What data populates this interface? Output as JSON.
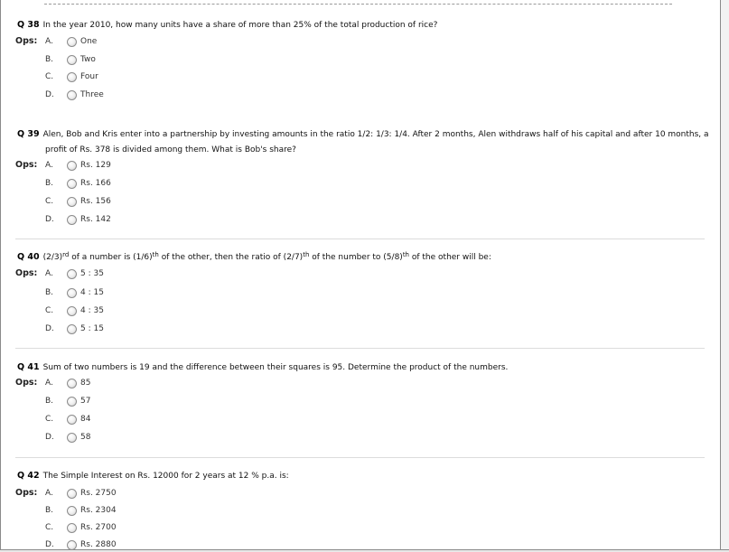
{
  "ops_label": "Ops:",
  "questions": [
    {
      "number": "Q 38",
      "text": "In the year 2010, how many units have a share of more than 25% of the total production of rice?",
      "options": [
        {
          "letter": "A.",
          "text": "One"
        },
        {
          "letter": "B.",
          "text": "Two"
        },
        {
          "letter": "C.",
          "text": "Four"
        },
        {
          "letter": "D.",
          "text": "Three"
        }
      ]
    },
    {
      "number": "Q 39",
      "text_line1": "Alen, Bob and Kris enter into a partnership by investing amounts in the ratio 1/2: 1/3: 1/4. After 2 months, Alen withdraws half of his capital and after 10 months, a",
      "text_line2": "profit of Rs. 378 is divided among them. What is Bob's share?",
      "options": [
        {
          "letter": "A.",
          "text": "Rs. 129"
        },
        {
          "letter": "B.",
          "text": "Rs. 166"
        },
        {
          "letter": "C.",
          "text": "Rs. 156"
        },
        {
          "letter": "D.",
          "text": "Rs. 142"
        }
      ]
    },
    {
      "number": "Q 40",
      "text_parts": {
        "p1": "(2/3)",
        "s1": "rd",
        "p2": " of a number is (1/6)",
        "s2": "th",
        "p3": " of the other, then the ratio of (2/7)",
        "s3": "th",
        "p4": " of the number to (5/8)",
        "s4": "th",
        "p5": " of the other will be:"
      },
      "options": [
        {
          "letter": "A.",
          "text": "5 : 35"
        },
        {
          "letter": "B.",
          "text": "4 : 15"
        },
        {
          "letter": "C.",
          "text": "4 : 35"
        },
        {
          "letter": "D.",
          "text": "5 : 15"
        }
      ]
    },
    {
      "number": "Q 41",
      "text": "Sum of two numbers is 19 and the difference between their squares is 95. Determine the product of the numbers.",
      "options": [
        {
          "letter": "A.",
          "text": "85"
        },
        {
          "letter": "B.",
          "text": "57"
        },
        {
          "letter": "C.",
          "text": "84"
        },
        {
          "letter": "D.",
          "text": "58"
        }
      ]
    },
    {
      "number": "Q 42",
      "text": "The Simple Interest on Rs. 12000 for 2 years at 12 % p.a. is:",
      "options": [
        {
          "letter": "A.",
          "text": "Rs. 2750"
        },
        {
          "letter": "B.",
          "text": "Rs. 2304"
        },
        {
          "letter": "C.",
          "text": "Rs. 2700"
        },
        {
          "letter": "D.",
          "text": "Rs. 2880"
        }
      ]
    }
  ]
}
